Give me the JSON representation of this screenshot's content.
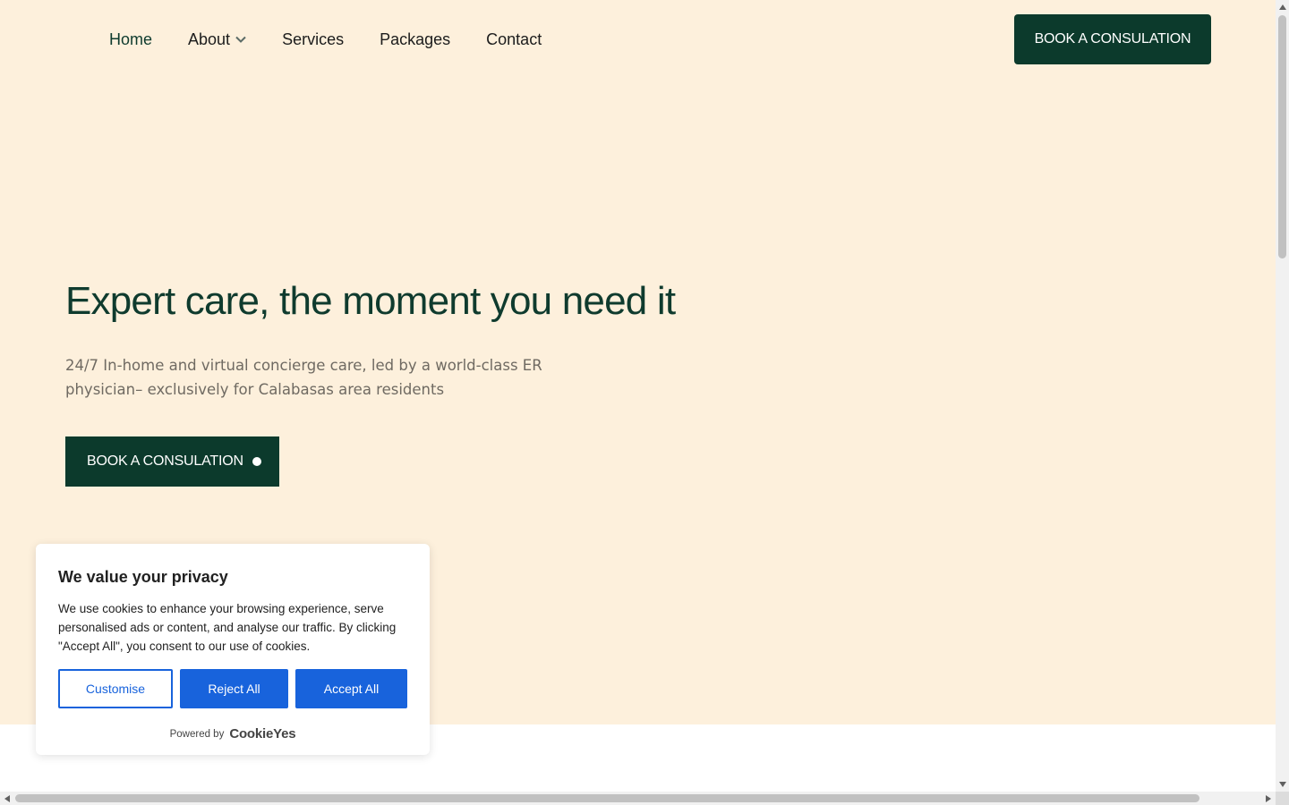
{
  "nav": {
    "items": [
      {
        "label": "Home",
        "active": true
      },
      {
        "label": "About",
        "has_dropdown": true
      },
      {
        "label": "Services"
      },
      {
        "label": "Packages"
      },
      {
        "label": "Contact"
      }
    ],
    "cta_label": "BOOK A CONSULATION"
  },
  "hero": {
    "title": "Expert care, the moment you need it",
    "subtitle": "24/7 In-home and virtual concierge care, led by a world-class ER physician– exclusively for Calabasas area residents",
    "cta_label": "BOOK A CONSULATION"
  },
  "cookie_banner": {
    "title": "We value your privacy",
    "text": "We use cookies to enhance your browsing experience, serve personalised ads or content, and analyse our traffic. By clicking \"Accept All\", you consent to our use of cookies.",
    "customise_label": "Customise",
    "reject_label": "Reject All",
    "accept_label": "Accept All",
    "powered_by": "Powered by",
    "brand": "CookieYes"
  },
  "colors": {
    "hero_bg": "#fdf0dc",
    "brand_green": "#0c3a2c",
    "cookie_blue": "#1863dc"
  },
  "icons": {
    "about_dropdown": "chevron-down-icon",
    "cta_dot": "dot-icon"
  }
}
